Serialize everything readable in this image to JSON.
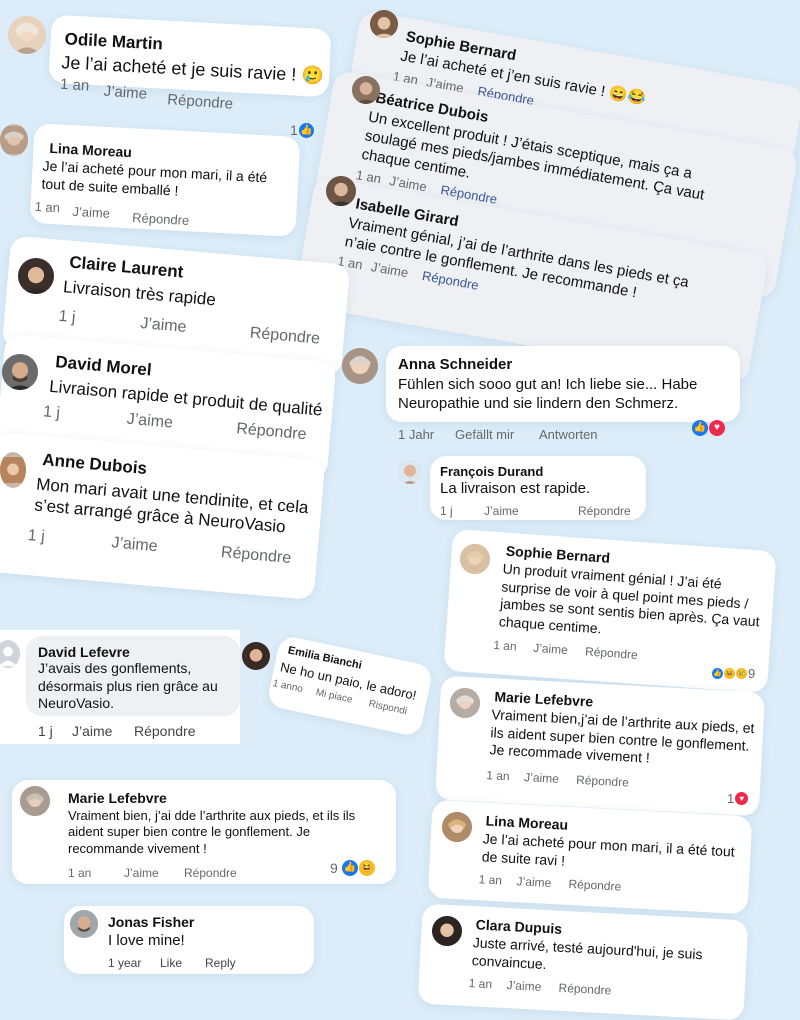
{
  "comments": [
    {
      "name": "Odile Martin",
      "text": "Je l’ai acheté et je suis ravie ! 🥲",
      "time": "1 an",
      "like": "J’aime",
      "reply": "Répondre",
      "count": "1"
    },
    {
      "name": "Sophie Bernard",
      "text": "Je l’ai acheté et j’en suis ravie ! 😄😂",
      "time": "1 an",
      "like": "J’aime",
      "reply": "Répondre"
    },
    {
      "name": "Béatrice Dubois",
      "text": "Un excellent produit ! J’étais sceptique, mais ça a soulagé mes pieds/jambes immédiatement. Ça vaut chaque centime.",
      "time": "1 an",
      "like": "J’aime",
      "reply": "Répondre"
    },
    {
      "name": "Lina Moreau",
      "text": "Je l’ai acheté pour mon mari, il a été tout de suite emballé !",
      "time": "1 an",
      "like": "J’aime",
      "reply": "Répondre"
    },
    {
      "name": "Isabelle Girard",
      "text": "Vraiment génial, j’ai de l’arthrite dans les pieds et ça n’aie contre le gonflement. Je recommande !",
      "time": "1 an",
      "like": "J’aime",
      "reply": "Répondre"
    },
    {
      "name": "Claire Laurent",
      "text": "Livraison très rapide",
      "time": "1 j",
      "like": "J’aime",
      "reply": "Répondre"
    },
    {
      "name": "David Morel",
      "text": "Livraison rapide et produit de qualité",
      "time": "1 j",
      "like": "J’aime",
      "reply": "Répondre"
    },
    {
      "name": "Anna Schneider",
      "text": "Fühlen sich sooo gut an! Ich liebe sie... Habe Neuropathie und sie lindern den Schmerz.",
      "time": "1 Jahr",
      "like": "Gefällt mir",
      "reply": "Antworten"
    },
    {
      "name": "François Durand",
      "text": "La livraison est rapide.",
      "time": "1 j",
      "like": "J’aime",
      "reply": "Répondre"
    },
    {
      "name": "Anne Dubois",
      "text": "Mon mari avait une tendinite, et cela s’est arrangé grâce à NeuroVasio",
      "time": "1 j",
      "like": "J’aime",
      "reply": "Répondre"
    },
    {
      "name": "Sophie Bernard",
      "text": "Un produit vraiment génial ! J’ai été surprise de voir à quel point mes pieds / jambes se sont sentis bien après. Ça vaut chaque centime.",
      "time": "1 an",
      "like": "J’aime",
      "reply": "Répondre",
      "count": "9"
    },
    {
      "name": "David Lefevre",
      "text": "J’avais des gonflements, désormais plus rien grâce au NeuroVasio.",
      "time": "1 j",
      "like": "J’aime",
      "reply": "Répondre"
    },
    {
      "name": "Emilia Bianchi",
      "text": "Ne ho un paio, le adoro!",
      "time": "1 anno",
      "like": "Mi piace",
      "reply": "Rispondi"
    },
    {
      "name": "Marie Lefebvre",
      "text": "Vraiment bien,j’ai de l’arthrite aux pieds, et ils aident super bien contre le gonflement. Je recommade vivement !",
      "time": "1 an",
      "like": "J’aime",
      "reply": "Répondre",
      "count": "1"
    },
    {
      "name": "Marie Lefebvre",
      "text": "Vraiment bien, j’ai dde l’arthrite aux pieds, et ils ils aident super bien contre le gonflement. Je recommande vivement !",
      "time": "1 an",
      "like": "J’aime",
      "reply": "Répondre",
      "count": "9"
    },
    {
      "name": "Lina Moreau",
      "text": "Je l’ai acheté pour mon mari, il a été tout de suite ravi !",
      "time": "1 an",
      "like": "J’aime",
      "reply": "Répondre"
    },
    {
      "name": "Jonas Fisher",
      "text": "I love mine!",
      "time": "1 year",
      "like": "Like",
      "reply": "Reply"
    },
    {
      "name": "Clara Dupuis",
      "text": "Juste arrivé, testé aujourd'hui, je suis convaincue.",
      "time": "1 an",
      "like": "J’aime",
      "reply": "Répondre"
    }
  ],
  "colors": {
    "background": "#dcedf9",
    "like": "#1877f2",
    "love": "#f02849",
    "haha": "#f7b928",
    "reply_blue": "#385898"
  }
}
